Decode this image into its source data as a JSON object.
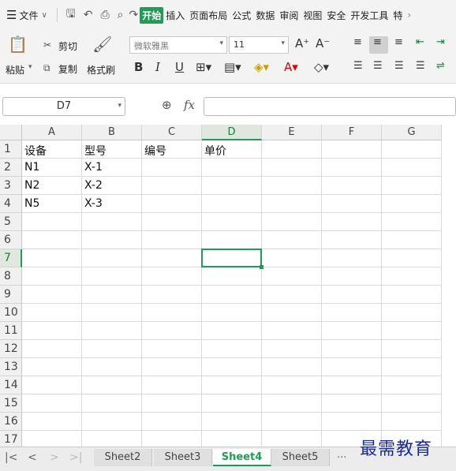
{
  "menubar": {
    "file_label": "文件",
    "items": [
      "开始",
      "插入",
      "页面布局",
      "公式",
      "数据",
      "审阅",
      "视图",
      "安全",
      "开发工具",
      "特"
    ]
  },
  "ribbon": {
    "paste": "粘贴",
    "cut": "剪切",
    "copy": "复制",
    "format_painter": "格式刷",
    "font_name": "微软雅黑",
    "font_size": "11",
    "bold": "B",
    "italic": "I",
    "underline": "U"
  },
  "formula_bar": {
    "name_box": "D7",
    "fx": "fx",
    "value": ""
  },
  "sheet": {
    "columns": [
      "A",
      "B",
      "C",
      "D",
      "E",
      "F",
      "G"
    ],
    "rows": [
      "1",
      "2",
      "3",
      "4",
      "5",
      "6",
      "7",
      "8",
      "9",
      "10",
      "11",
      "12",
      "13",
      "14",
      "15",
      "16",
      "17"
    ],
    "cells": {
      "A1": "设备",
      "B1": "型号",
      "C1": "编号",
      "D1": "单价",
      "A2": "N1",
      "B2": "X-1",
      "A3": "N2",
      "B3": "X-2",
      "A4": "N5",
      "B4": "X-3"
    },
    "active_cell": "D7",
    "accent": "#1f9d55"
  },
  "tabs": {
    "items": [
      "Sheet2",
      "Sheet3",
      "Sheet4",
      "Sheet5"
    ],
    "active": "Sheet4",
    "more": "···"
  },
  "watermark": "最需教育"
}
